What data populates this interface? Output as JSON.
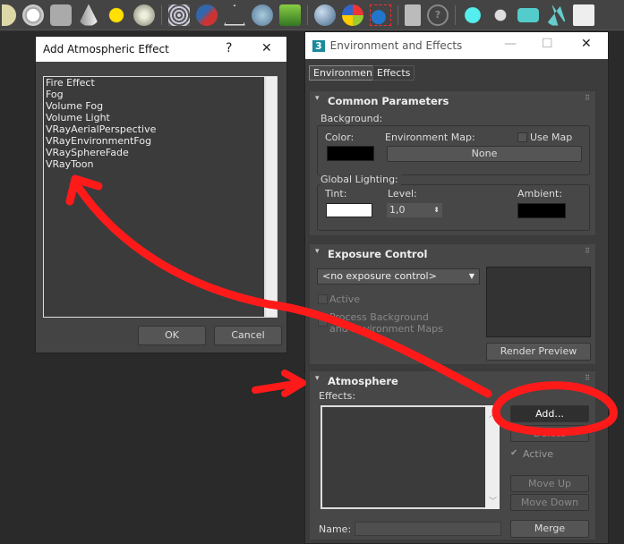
{
  "toolbar": {
    "icons": [
      "sphere-icon",
      "light-bulb-ring-icon",
      "teapot-icon",
      "cone-icon",
      "sun-icon",
      "sphere-light-icon",
      "particles-icon",
      "molecule-icon",
      "tower-icon",
      "spiky-ball-icon",
      "grass-icon",
      "material-sphere-icon",
      "color-balls-icon",
      "render-region-icon",
      "clipboard-icon",
      "help-icon",
      "lightbulb-icon",
      "sun-light-icon",
      "camera-icon",
      "trees-icon",
      "panel-icon"
    ]
  },
  "add_dialog": {
    "title": "Add Atmospheric Effect",
    "help": "?",
    "close": "✕",
    "items": [
      "Fire Effect",
      "Fog",
      "Volume Fog",
      "Volume Light",
      "VRayAerialPerspective",
      "VRayEnvironmentFog",
      "VRaySphereFade",
      "VRayToon"
    ],
    "ok": "OK",
    "cancel": "Cancel"
  },
  "env_dialog": {
    "title": "Environment and Effects",
    "app_icon": "3",
    "minimize": "—",
    "maximize": "☐",
    "close": "✕",
    "tabs": [
      "Environment",
      "Effects"
    ],
    "common": {
      "title": "Common Parameters",
      "background": "Background:",
      "color": "Color:",
      "env_map": "Environment Map:",
      "use_map": "Use Map",
      "none": "None",
      "global_lighting": "Global Lighting:",
      "tint": "Tint:",
      "level": "Level:",
      "level_value": "1,0",
      "ambient": "Ambient:",
      "color_value": "#000000",
      "tint_value": "#ffffff",
      "ambient_value": "#000000"
    },
    "exposure": {
      "title": "Exposure Control",
      "select": "<no exposure control>",
      "active": "Active",
      "process_bg": "Process Background",
      "process_bg2": "and Environment Maps",
      "render_preview": "Render Preview"
    },
    "atmosphere": {
      "title": "Atmosphere",
      "effects": "Effects:",
      "add": "Add...",
      "delete": "Delete",
      "active": "Active",
      "move_up": "Move Up",
      "move_down": "Move Down",
      "name": "Name:",
      "merge": "Merge"
    }
  },
  "annotation_color": "#ff1a1a"
}
